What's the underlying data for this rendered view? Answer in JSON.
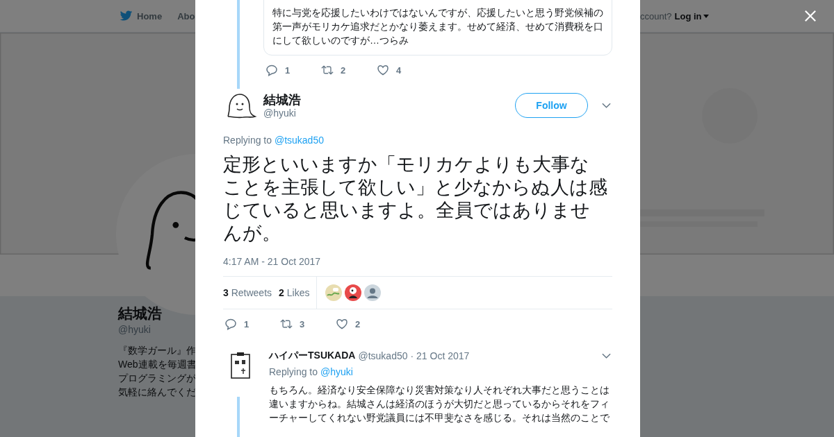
{
  "background_page": {
    "nav": {
      "items": [
        {
          "label": "Home"
        },
        {
          "label": "Abo"
        }
      ],
      "account_prompt": "ccount?",
      "login": "Log in"
    },
    "banner": {
      "kind": "picture"
    },
    "profile": {
      "name": "結城浩",
      "handle": "@hyuki",
      "bio_lines": [
        "『数学ガール』作",
        "Web連載を毎週書",
        "プログラミングが",
        "気軽に絡んでくだ"
      ]
    }
  },
  "modal": {
    "quoted_tweet": {
      "text_lines": [
        "特に与党を応援したいわけではないんですが、応援したいと思う野党候補の",
        "第一声がモリカケ追求だとかなり萎えます。せめて経済、せめて消費税を口",
        "にして欲しいのですが…つらみ"
      ]
    },
    "quoted_actions": [
      {
        "kind": "reply",
        "count": "1"
      },
      {
        "kind": "retweet",
        "count": "2"
      },
      {
        "kind": "like",
        "count": "4"
      }
    ],
    "tweet": {
      "name": "結城浩",
      "handle": "@hyuki",
      "follow": "Follow",
      "replying_label": "Replying to",
      "replying_to": "@tsukad50",
      "text_lines": [
        "定形といいますか「モリカケよりも大事な",
        "ことを主張して欲しい」と少なからぬ人は感",
        "じていると思いますよ。全員ではありませ",
        "んが。"
      ],
      "time": "4:17 AM - 21 Oct 2017",
      "stats": [
        {
          "count": "3",
          "label": "Retweets"
        },
        {
          "count": "2",
          "label": "Likes"
        }
      ],
      "likers": [
        {
          "kind": "picture"
        },
        {
          "kind": "picture"
        },
        {
          "kind": "default"
        }
      ],
      "actions": [
        {
          "kind": "reply",
          "count": "1"
        },
        {
          "kind": "retweet",
          "count": "3"
        },
        {
          "kind": "like",
          "count": "2"
        }
      ]
    },
    "reply": {
      "name": "ハイパーTSUKADA",
      "handle": "@tsukad50",
      "date": "· 21 Oct 2017",
      "replying_label": "Replying to",
      "replying_to": "@hyuki",
      "text_lines": [
        "もちろん。経済なり安全保障なり災害対策なり人それぞれ大事だと思うことは",
        "違いますからね。結城さんは経済のほうが大切だと思っているからそれをフィ",
        "ーチャーしてくれない野党議員には不甲斐なさを感じる。それは当然のことで"
      ]
    }
  }
}
